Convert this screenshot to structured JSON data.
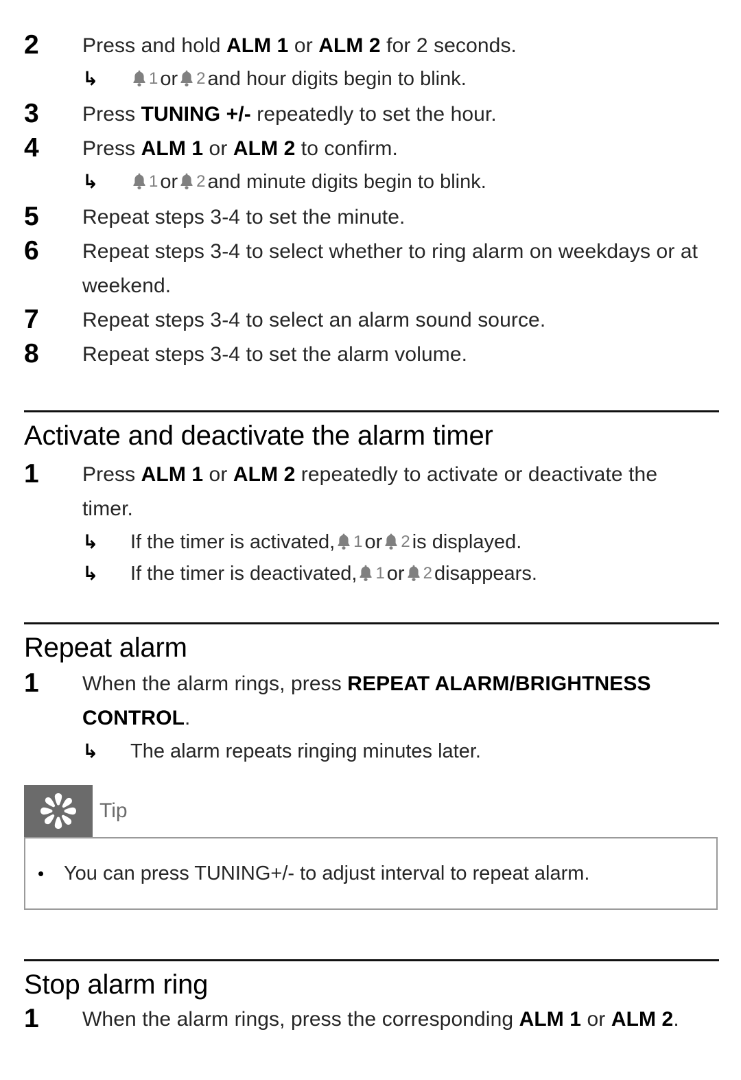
{
  "document": {
    "type": "product-manual-page",
    "colors": {
      "text": "#262626",
      "heading": "#000000",
      "rule": "#111111",
      "bell_icon": "#808080",
      "tip_gray": "#6b6b6b",
      "tip_border": "#9a9a9a"
    }
  },
  "icons": {
    "arrow": "↳",
    "bullet": "•",
    "bell_1_label": "1",
    "bell_2_label": "2"
  },
  "steps_continued": [
    {
      "num": "2",
      "text_parts": [
        {
          "t": "Press and hold ",
          "bold": false
        },
        {
          "t": "ALM 1",
          "bold": true
        },
        {
          "t": " or ",
          "bold": false
        },
        {
          "t": "ALM 2",
          "bold": true
        },
        {
          "t": " for 2 seconds.",
          "bold": false
        }
      ],
      "plain": "Press and hold ALM 1 or ALM 2 for 2 seconds.",
      "result": {
        "before": "",
        "between": "or",
        "after": "and hour digits begin to blink.",
        "plain": "↳ 1 or 2 and hour digits begin to blink."
      }
    },
    {
      "num": "3",
      "plain": "Press TUNING +/- repeatedly to set the hour.",
      "pre": "Press ",
      "bold": "TUNING +/-",
      "post": " repeatedly to set the hour."
    },
    {
      "num": "4",
      "plain": "Press ALM 1 or ALM 2 to confirm.",
      "pre": "Press ",
      "bold1": "ALM 1",
      "mid": " or ",
      "bold2": "ALM 2",
      "post": " to confirm.",
      "result": {
        "between": "or",
        "after": "and minute digits begin to blink.",
        "plain": "↳ 1 or 2 and minute digits begin to blink."
      }
    },
    {
      "num": "5",
      "plain": "Repeat steps 3-4 to set the minute."
    },
    {
      "num": "6",
      "plain": "Repeat steps 3-4 to select whether to ring alarm on weekdays or at weekend."
    },
    {
      "num": "7",
      "plain": "Repeat steps 3-4 to select an alarm sound source."
    },
    {
      "num": "8",
      "plain": "Repeat steps 3-4 to set the alarm volume."
    }
  ],
  "section_activate": {
    "title": "Activate and deactivate the alarm timer",
    "step": {
      "num": "1",
      "pre": "Press ",
      "bold1": "ALM 1",
      "mid": " or ",
      "bold2": "ALM 2",
      "post": " repeatedly to activate or deactivate the timer.",
      "plain": "Press ALM 1 or ALM 2 repeatedly to activate or deactivate the timer."
    },
    "results": [
      {
        "before": "If the timer is activated,",
        "between": "or",
        "after": "is displayed.",
        "plain": "If the timer is activated, 1 or 2 is displayed."
      },
      {
        "before": "If the timer is deactivated,",
        "between": "or",
        "after": "disappears.",
        "plain": "If the timer is deactivated, 1 or 2 disappears."
      }
    ]
  },
  "section_repeat": {
    "title": "Repeat alarm",
    "step": {
      "num": "1",
      "pre": "When the alarm rings, press ",
      "bold": "REPEAT ALARM/BRIGHTNESS CONTROL",
      "post": ".",
      "plain": "When the alarm rings, press REPEAT ALARM/BRIGHTNESS CONTROL."
    },
    "result": {
      "text": "The alarm repeats ringing minutes later."
    }
  },
  "tip": {
    "label": "Tip",
    "icon_name": "asterisk-flower-icon",
    "bullets": [
      "You can press TUNING+/- to adjust interval to repeat alarm."
    ]
  },
  "section_stop": {
    "title": "Stop alarm ring",
    "step": {
      "num": "1",
      "pre": "When the alarm rings, press the corresponding ",
      "bold1": "ALM 1",
      "mid": " or ",
      "bold2": "ALM 2",
      "post": ".",
      "plain": "When the alarm rings, press the corresponding ALM 1 or ALM 2."
    }
  }
}
